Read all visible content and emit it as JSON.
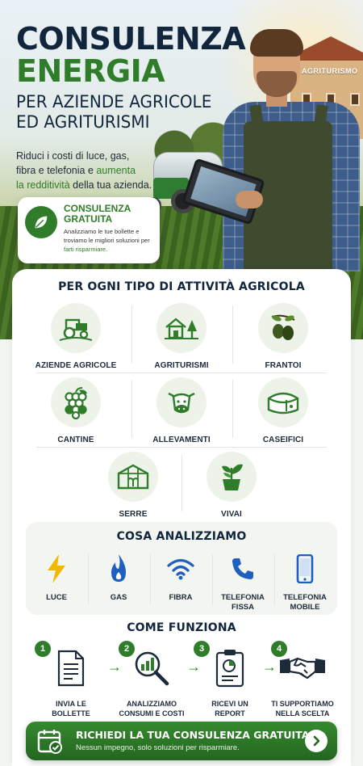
{
  "hero": {
    "title_line1": "CONSULENZA",
    "title_line2": "ENERGIA",
    "subtitle_line1": "PER AZIENDE AGRICOLE",
    "subtitle_line2": "ED AGRITURISMI",
    "desc_part1": "Riduci i costi di luce, gas,",
    "desc_part2": "fibra e telefonia e ",
    "desc_highlight1": "aumenta",
    "desc_highlight2": "la redditività",
    "desc_part3": " della tua azienda.",
    "farmhouse_sign": "AGRITURISMO"
  },
  "badge": {
    "title_line1": "CONSULENZA",
    "title_line2": "GRATUITA",
    "text_part1": "Analizziamo le tue bollette e troviamo le migliori soluzioni per ",
    "text_highlight": "farti risparmiare",
    "text_part2": ".",
    "icon": "leaf-icon"
  },
  "activities": {
    "title": "PER OGNI TIPO DI ATTIVITÀ AGRICOLA",
    "items": [
      {
        "label": "AZIENDE AGRICOLE",
        "icon": "tractor-icon"
      },
      {
        "label": "AGRITURISMI",
        "icon": "farmhouse-icon"
      },
      {
        "label": "FRANTOI",
        "icon": "olive-icon"
      },
      {
        "label": "CANTINE",
        "icon": "grapes-icon"
      },
      {
        "label": "ALLEVAMENTI",
        "icon": "cow-icon"
      },
      {
        "label": "CASEIFICI",
        "icon": "cheese-icon"
      },
      {
        "label": "SERRE",
        "icon": "greenhouse-icon"
      },
      {
        "label": "VIVAI",
        "icon": "plant-pot-icon"
      }
    ]
  },
  "analyze": {
    "title": "COSA ANALIZZIAMO",
    "items": [
      {
        "label": "LUCE",
        "icon": "lightning-icon",
        "color": "#f2b705"
      },
      {
        "label": "GAS",
        "icon": "flame-icon",
        "color": "#1f5fbf"
      },
      {
        "label": "FIBRA",
        "icon": "wifi-icon",
        "color": "#1f5fbf"
      },
      {
        "label_line1": "TELEFONIA",
        "label_line2": "FISSA",
        "icon": "phone-icon",
        "color": "#1f5fbf"
      },
      {
        "label_line1": "TELEFONIA",
        "label_line2": "MOBILE",
        "icon": "smartphone-icon",
        "color": "#1f5fbf"
      }
    ]
  },
  "how": {
    "title": "COME FUNZIONA",
    "steps": [
      {
        "num": "1",
        "line1": "INVIA LE",
        "line2": "BOLLETTE",
        "icon": "document-icon"
      },
      {
        "num": "2",
        "line1": "ANALIZZIAMO",
        "line2": "CONSUMI E COSTI",
        "icon": "magnifier-chart-icon"
      },
      {
        "num": "3",
        "line1": "RICEVI UN",
        "line2": "REPORT",
        "icon": "clipboard-report-icon"
      },
      {
        "num": "4",
        "line1": "TI SUPPORTIAMO",
        "line2": "NELLA SCELTA",
        "icon": "handshake-icon"
      }
    ]
  },
  "cta": {
    "title": "RICHIEDI LA TUA CONSULENZA GRATUITA",
    "subtitle": "Nessun impegno, solo soluzioni per risparmiare.",
    "icon": "calendar-check-icon",
    "arrow_icon": "chevron-right-icon"
  },
  "colors": {
    "brand_green": "#2f7d2a",
    "navy": "#11253c",
    "accent_blue": "#1f5fbf",
    "accent_yellow": "#f2b705"
  }
}
